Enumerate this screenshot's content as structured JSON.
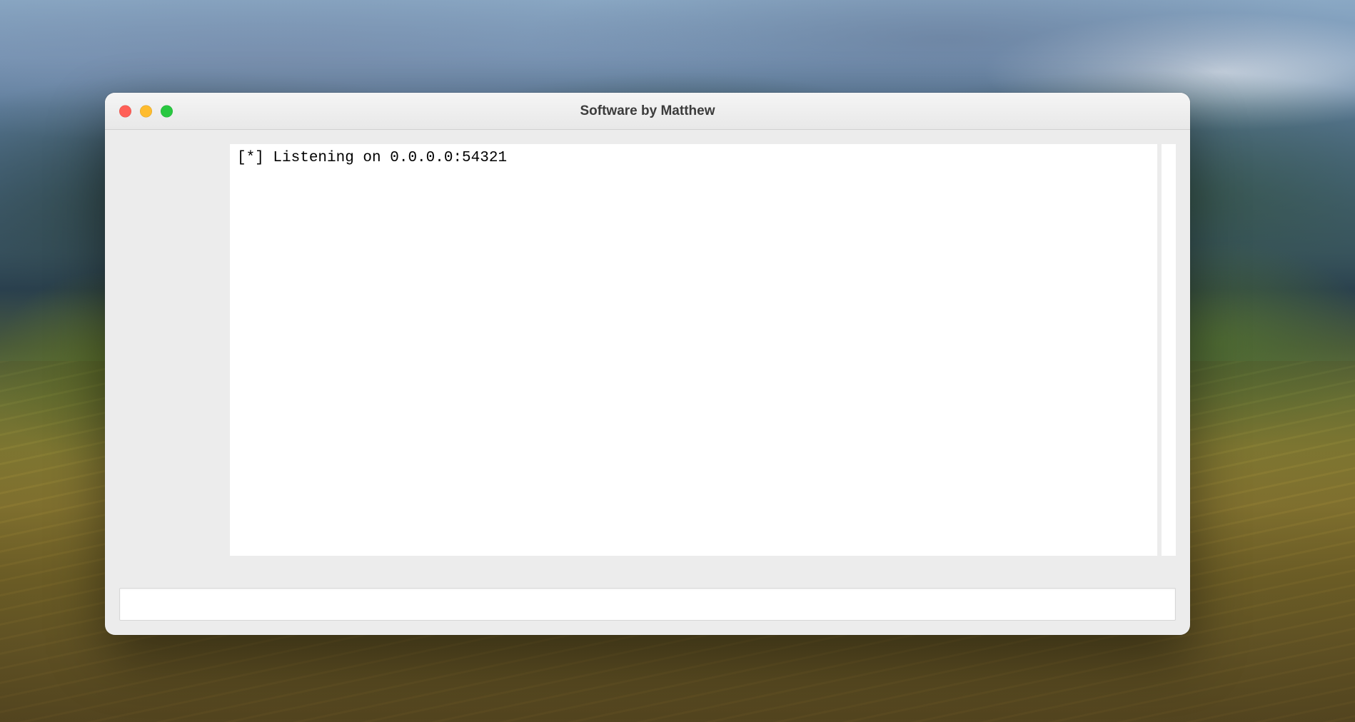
{
  "window": {
    "title": "Software by Matthew",
    "traffic_lights": {
      "close_color": "#ff5f57",
      "minimize_color": "#febc2e",
      "zoom_color": "#28c840"
    }
  },
  "console": {
    "output": "[*] Listening on 0.0.0.0:54321"
  },
  "input": {
    "value": "",
    "placeholder": ""
  }
}
